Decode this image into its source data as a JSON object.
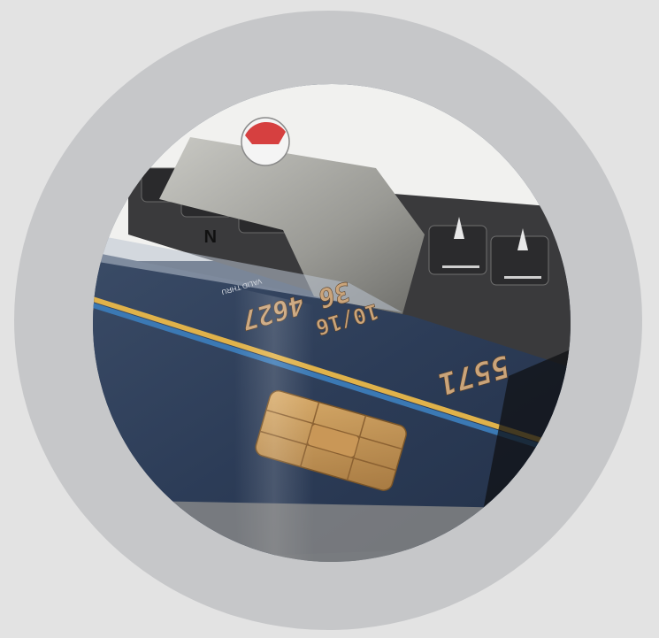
{
  "image": {
    "subject": "Credit card inserted in a card reader slot",
    "frame": "circular photo"
  },
  "card": {
    "number_fragment_1": "36 4627",
    "number_fragment_2": "5571",
    "valid_thru": "10/16",
    "label_small": "VALID THRU",
    "letter_mark": "N"
  },
  "colors": {
    "outer_ring": "#c6c7c9",
    "background": "#e3e3e3",
    "card_blue": "#2e3d55",
    "emboss_gold": "#caa47a",
    "chip_gold": "#c89858",
    "stripe_yellow": "#e0b24a",
    "stripe_blue": "#3b79b4"
  }
}
